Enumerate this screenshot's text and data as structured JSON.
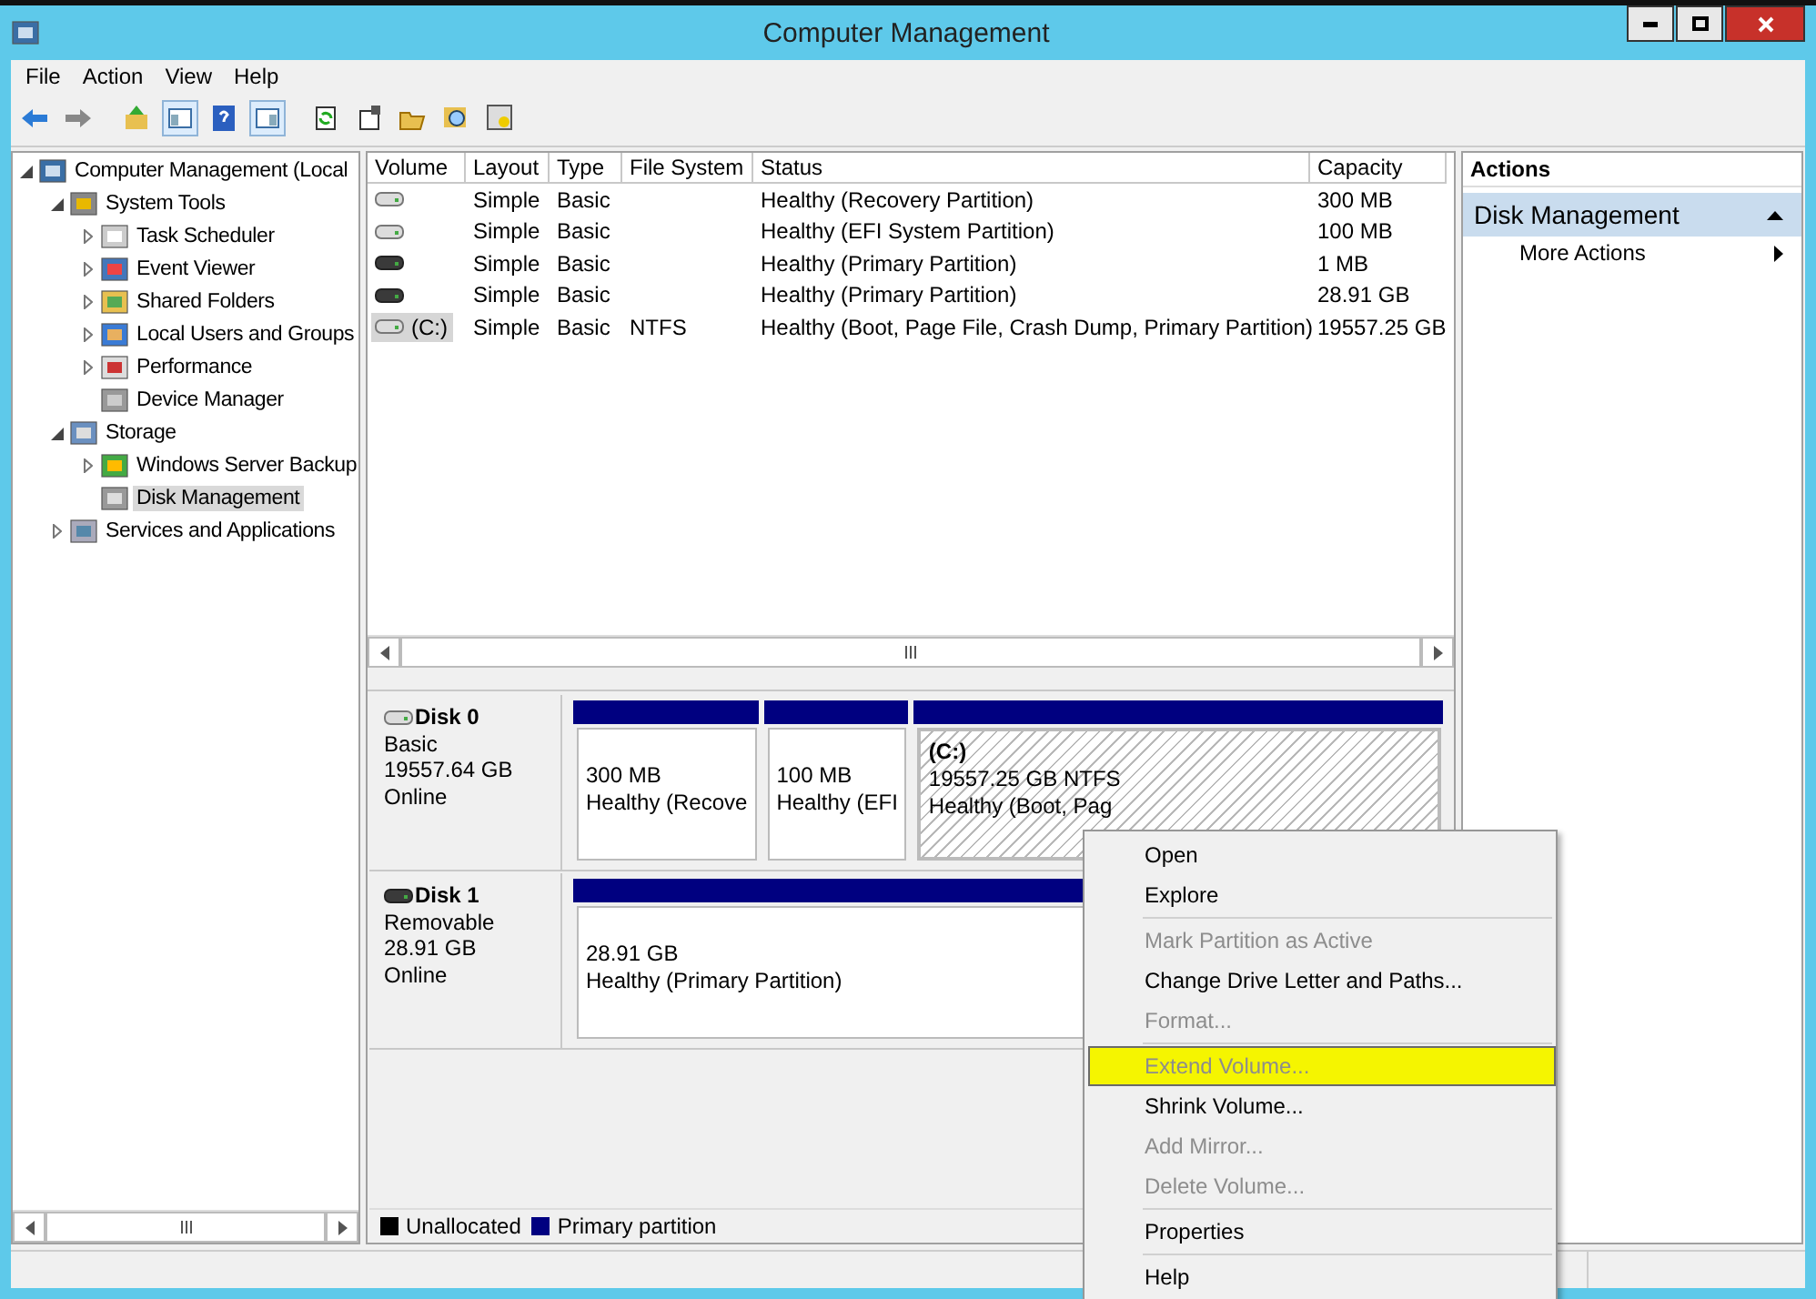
{
  "window": {
    "title": "Computer Management"
  },
  "menu": [
    "File",
    "Action",
    "View",
    "Help"
  ],
  "tree": [
    {
      "label": "Computer Management (Local",
      "expanded": true,
      "selected": false,
      "children": [
        {
          "label": "System Tools",
          "expanded": true,
          "selected": false,
          "children": [
            {
              "label": "Task Scheduler",
              "expanded": false,
              "selected": false
            },
            {
              "label": "Event Viewer",
              "expanded": false,
              "selected": false
            },
            {
              "label": "Shared Folders",
              "expanded": false,
              "selected": false
            },
            {
              "label": "Local Users and Groups",
              "expanded": false,
              "selected": false
            },
            {
              "label": "Performance",
              "expanded": false,
              "selected": false
            },
            {
              "label": "Device Manager",
              "selected": false
            }
          ]
        },
        {
          "label": "Storage",
          "expanded": true,
          "selected": false,
          "children": [
            {
              "label": "Windows Server Backup",
              "expanded": false,
              "selected": false
            },
            {
              "label": "Disk Management",
              "selected": true
            }
          ]
        },
        {
          "label": "Services and Applications",
          "expanded": false,
          "selected": false
        }
      ]
    }
  ],
  "table": {
    "columns": [
      "Volume",
      "Layout",
      "Type",
      "File System",
      "Status",
      "Capacity"
    ],
    "rows": [
      {
        "kind": "fixed",
        "selected": false,
        "layout": "Simple",
        "type": "Basic",
        "status": "Healthy (Recovery Partition)",
        "capacity": "300 MB"
      },
      {
        "kind": "fixed",
        "selected": false,
        "layout": "Simple",
        "type": "Basic",
        "status": "Healthy (EFI System Partition)",
        "capacity": "100 MB"
      },
      {
        "kind": "removable",
        "selected": false,
        "layout": "Simple",
        "type": "Basic",
        "status": "Healthy (Primary Partition)",
        "capacity": "1 MB"
      },
      {
        "kind": "removable",
        "selected": false,
        "layout": "Simple",
        "type": "Basic",
        "status": "Healthy (Primary Partition)",
        "capacity": "28.91 GB"
      },
      {
        "kind": "fixed",
        "volume": "(C:)",
        "selected": true,
        "layout": "Simple",
        "type": "Basic",
        "file_system": "NTFS",
        "status": "Healthy (Boot, Page File, Crash Dump, Primary Partition)",
        "capacity": "19557.25 GB"
      }
    ]
  },
  "disks": [
    {
      "name": "Disk 0",
      "kind": "fixed",
      "type": "Basic",
      "size": "19557.64 GB",
      "state": "Online",
      "partitions": [
        {
          "size": "300 MB",
          "status": "Healthy (Recove",
          "selected": false
        },
        {
          "size": "100 MB",
          "status": "Healthy (EFI",
          "selected": false
        },
        {
          "label": "(C:)",
          "size": "19557.25 GB NTFS",
          "status": "Healthy (Boot, Pag",
          "selected": true
        }
      ]
    },
    {
      "name": "Disk 1",
      "kind": "removable",
      "type": "Removable",
      "size": "28.91 GB",
      "state": "Online",
      "partitions": [
        {
          "size": "28.91 GB",
          "status": "Healthy (Primary Partition)",
          "selected": false
        }
      ]
    }
  ],
  "legend": [
    {
      "label": "Unallocated",
      "color": "#000000"
    },
    {
      "label": "Primary partition",
      "color": "#000080"
    }
  ],
  "actions": {
    "title": "Actions",
    "section": "Disk Management",
    "items": [
      "More Actions"
    ]
  },
  "context_menu": [
    {
      "items": [
        {
          "label": "Open",
          "disabled": false,
          "highlighted": false
        },
        {
          "label": "Explore",
          "disabled": false,
          "highlighted": false
        }
      ]
    },
    {
      "items": [
        {
          "label": "Mark Partition as Active",
          "disabled": true,
          "highlighted": false
        },
        {
          "label": "Change Drive Letter and Paths...",
          "disabled": false,
          "highlighted": false
        },
        {
          "label": "Format...",
          "disabled": true,
          "highlighted": false
        }
      ]
    },
    {
      "items": [
        {
          "label": "Extend Volume...",
          "disabled": true,
          "highlighted": true
        },
        {
          "label": "Shrink Volume...",
          "disabled": false,
          "highlighted": false
        },
        {
          "label": "Add Mirror...",
          "disabled": true,
          "highlighted": false
        },
        {
          "label": "Delete Volume...",
          "disabled": true,
          "highlighted": false
        }
      ]
    },
    {
      "items": [
        {
          "label": "Properties",
          "disabled": false,
          "highlighted": false
        }
      ]
    },
    {
      "items": [
        {
          "label": "Help",
          "disabled": false,
          "highlighted": false
        }
      ]
    }
  ]
}
